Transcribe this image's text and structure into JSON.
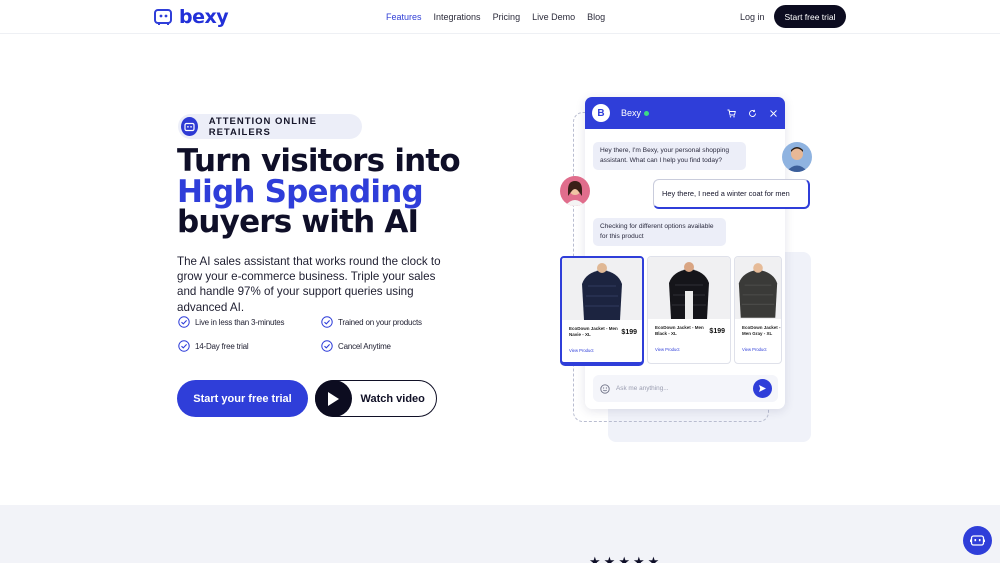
{
  "brand": {
    "name": "bexy",
    "accent": "#2f3ed9",
    "dark": "#0c0c20"
  },
  "nav": {
    "links": [
      {
        "label": "Features",
        "active": true
      },
      {
        "label": "Integrations",
        "active": false
      },
      {
        "label": "Pricing",
        "active": false
      },
      {
        "label": "Live Demo",
        "active": false
      },
      {
        "label": "Blog",
        "active": false
      }
    ],
    "login": "Log in",
    "cta": "Start free trial"
  },
  "hero": {
    "badge": "ATTENTION ONLINE RETAILERS",
    "headline": {
      "line1": "Turn visitors into",
      "line2": "High Spending",
      "line3": "buyers with AI"
    },
    "description": "The AI sales assistant that works round the clock to grow your e-commerce business. Triple your sales and handle 97% of your support queries using advanced AI.",
    "features": [
      "Live in less than 3-minutes",
      "Trained on your products",
      "14-Day free trial",
      "Cancel Anytime"
    ],
    "primary_button": "Start your free trial",
    "video_button": "Watch video"
  },
  "chat": {
    "avatar_letter": "B",
    "bot_name": "Bexy",
    "greeting": "Hey there, I'm Bexy, your personal shopping assistant. What can I help you find today?",
    "user_message": "Hey there, I need a winter coat for men",
    "bot_status": "Checking for different options available for this product",
    "products": [
      {
        "name": "EcoDown Jacket - Men Navie - XL",
        "price": "$199",
        "link": "View Product"
      },
      {
        "name": "EcoDown Jacket - Men Black - XL",
        "price": "$199",
        "link": "View Product"
      },
      {
        "name": "EcoDown Jacket - Men Gray - XL",
        "price": "",
        "link": "View Product"
      }
    ],
    "input_placeholder": "Ask me anything..."
  },
  "icons": [
    "bexy-logo-icon",
    "robot-icon",
    "check-circle-icon",
    "play-icon",
    "cart-icon",
    "refresh-icon",
    "close-icon",
    "emoji-icon",
    "send-icon",
    "star-icon",
    "chat-bot-icon"
  ],
  "rating": {
    "stars": 5
  }
}
